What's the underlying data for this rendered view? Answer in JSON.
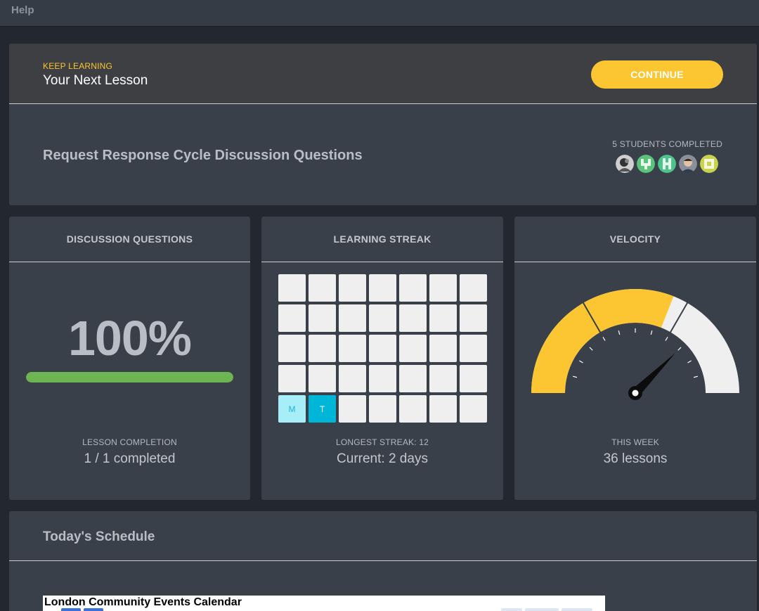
{
  "topbar": {
    "help_label": "Help"
  },
  "next_lesson": {
    "kicker": "KEEP LEARNING",
    "title": "Your Next Lesson",
    "continue_label": "CONTINUE",
    "lesson_name": "Request Response Cycle Discussion Questions",
    "students_completed_label": "5 STUDENTS COMPLETED",
    "avatars": [
      "avatar-1",
      "avatar-2",
      "avatar-3",
      "avatar-4",
      "avatar-5"
    ]
  },
  "discussion": {
    "header": "DISCUSSION QUESTIONS",
    "percent_text": "100%",
    "progress_fraction": 1.0,
    "sub_label": "LESSON COMPLETION",
    "value": "1 / 1 completed"
  },
  "streak": {
    "header": "LEARNING STREAK",
    "grid_rows": 5,
    "grid_cols": 7,
    "active_days": [
      {
        "label": "M",
        "level": "light"
      },
      {
        "label": "T",
        "level": "dark"
      }
    ],
    "sub_label": "LONGEST STREAK: 12",
    "value": "Current: 2 days"
  },
  "velocity": {
    "header": "VELOCITY",
    "gauge_fraction": 0.62,
    "sub_label": "THIS WEEK",
    "value": "36 lessons"
  },
  "schedule": {
    "title": "Today's Schedule",
    "calendar_title": "London Community Events Calendar"
  },
  "colors": {
    "accent_yellow": "#fcc632",
    "progress_green": "#6db552",
    "streak_light": "#a8eef9",
    "streak_dark": "#00b6d6"
  }
}
